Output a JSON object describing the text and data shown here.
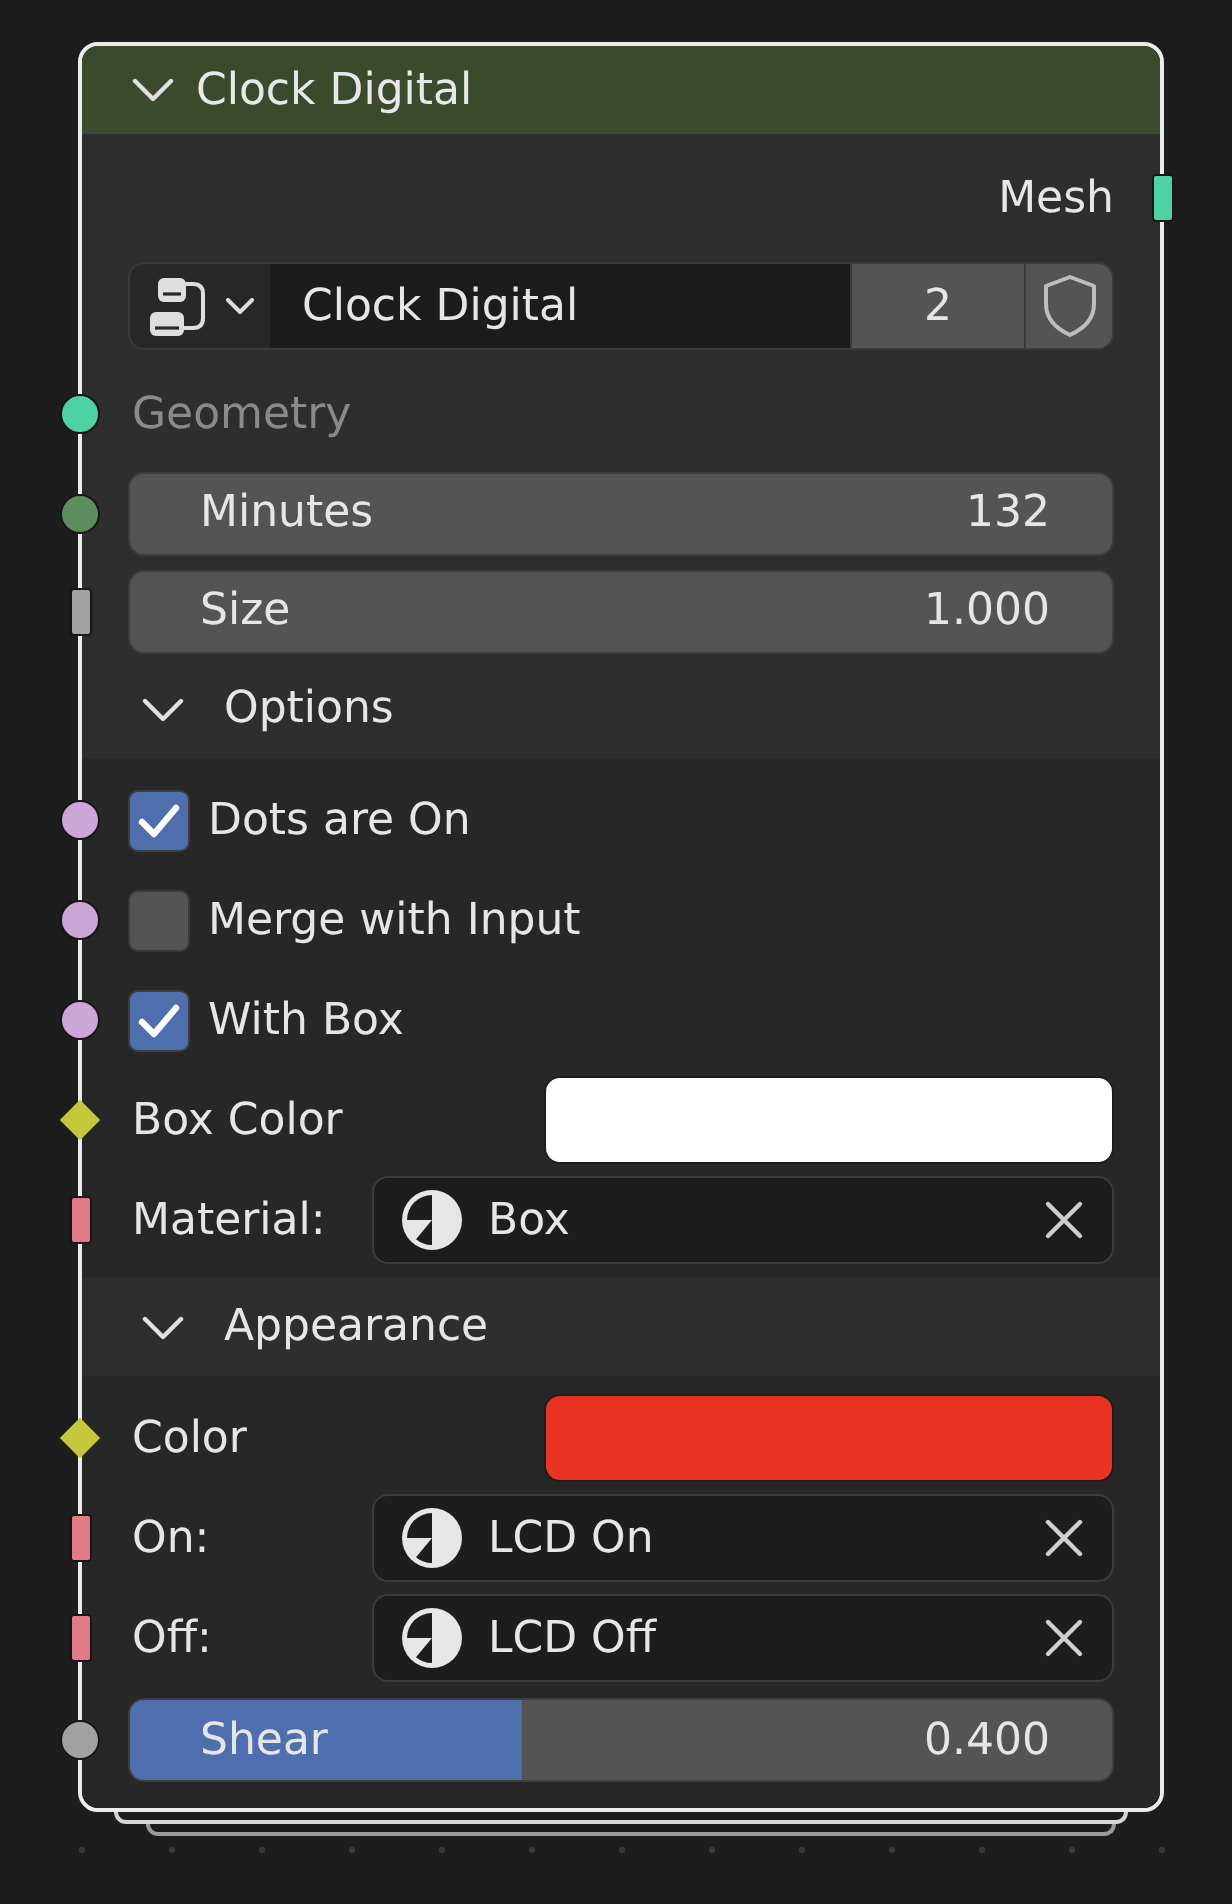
{
  "node": {
    "title": "Clock Digital",
    "expanded": true
  },
  "rows": [
    {
      "kind": "output",
      "label": "Mesh",
      "socket": {
        "kind": "bar",
        "color": "#4dd3a2"
      }
    },
    {
      "kind": "group",
      "name": "Clock Digital",
      "users": "2",
      "fake_user": false
    },
    {
      "kind": "label",
      "label": "Geometry",
      "socket": {
        "kind": "circle",
        "color": "#4dd3a2"
      }
    },
    {
      "kind": "number",
      "label": "Minutes",
      "value": "132",
      "socket": {
        "kind": "circle",
        "color": "#5d8c5d"
      }
    },
    {
      "kind": "number",
      "label": "Size",
      "value": "1.000",
      "socket": {
        "kind": "bar",
        "color": "#a1a1a1"
      }
    },
    {
      "kind": "panel",
      "label": "Options",
      "expanded": true,
      "children": [
        {
          "kind": "checkbox",
          "label": "Dots are On",
          "checked": true,
          "socket": {
            "kind": "circle",
            "color": "#cca6d6"
          }
        },
        {
          "kind": "checkbox",
          "label": "Merge with Input",
          "checked": false,
          "socket": {
            "kind": "circle",
            "color": "#cca6d6"
          }
        },
        {
          "kind": "checkbox",
          "label": "With Box",
          "checked": true,
          "socket": {
            "kind": "circle",
            "color": "#cca6d6"
          }
        },
        {
          "kind": "color",
          "label": "Box Color",
          "color": "#ffffff",
          "socket": {
            "kind": "diamond",
            "color": "#c7c73c"
          }
        },
        {
          "kind": "material",
          "label": "Material:",
          "value": "Box",
          "socket": {
            "kind": "bar",
            "color": "#e27a85"
          }
        }
      ]
    },
    {
      "kind": "panel",
      "label": "Appearance",
      "expanded": true,
      "children": [
        {
          "kind": "color",
          "label": "Color",
          "color": "#e83323",
          "socket": {
            "kind": "diamond",
            "color": "#c7c73c"
          }
        },
        {
          "kind": "material",
          "label": "On:",
          "value": "LCD On",
          "socket": {
            "kind": "bar",
            "color": "#e27a85"
          }
        },
        {
          "kind": "material",
          "label": "Off:",
          "value": "LCD Off",
          "socket": {
            "kind": "bar",
            "color": "#e27a85"
          }
        },
        {
          "kind": "slider",
          "label": "Shear",
          "value": "0.400",
          "level": 0.4,
          "socket": {
            "kind": "circle",
            "color": "#a1a1a1"
          }
        }
      ]
    }
  ]
}
